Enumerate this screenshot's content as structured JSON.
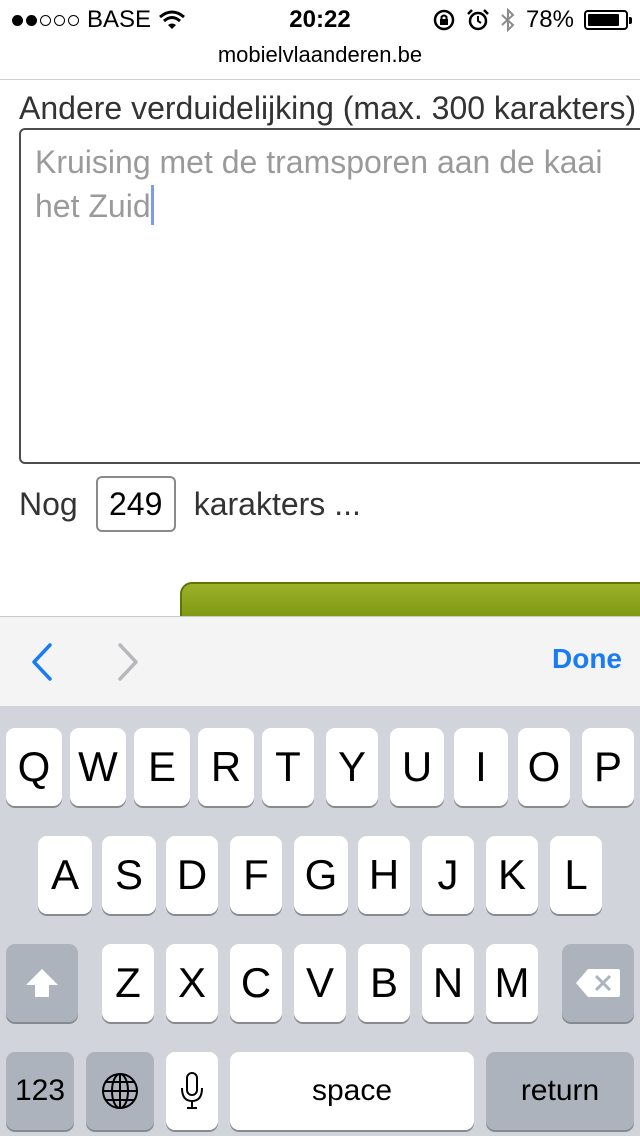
{
  "status": {
    "carrier": "BASE",
    "time": "20:22",
    "battery": "78%",
    "battery_level": 0.78
  },
  "browser": {
    "url": "mobielvlaanderen.be"
  },
  "form": {
    "label": "Andere verduidelijking (max. 300 karakters)",
    "textarea_lines": [
      "Kruising met de tramsporen aan de kaai",
      "het Zuid"
    ],
    "counter_prefix": "Nog",
    "counter_value": "249",
    "counter_suffix": "karakters ..."
  },
  "accessory": {
    "done_label": "Done"
  },
  "keyboard": {
    "row1": [
      "Q",
      "W",
      "E",
      "R",
      "T",
      "Y",
      "U",
      "I",
      "O",
      "P"
    ],
    "row2": [
      "A",
      "S",
      "D",
      "F",
      "G",
      "H",
      "J",
      "K",
      "L"
    ],
    "row3": [
      "Z",
      "X",
      "C",
      "V",
      "B",
      "N",
      "M"
    ],
    "numbers_label": "123",
    "space_label": "space",
    "return_label": "return"
  },
  "icons": {
    "signal": "signal-dots-icon",
    "wifi": "wifi-icon",
    "rotation_lock": "rotation-lock-icon",
    "alarm": "alarm-icon",
    "bluetooth": "bluetooth-icon",
    "battery": "battery-icon",
    "prev": "chevron-left-icon",
    "next": "chevron-right-icon",
    "shift": "shift-icon",
    "backspace": "backspace-icon",
    "globe": "globe-icon",
    "mic": "microphone-icon"
  },
  "colors": {
    "done": "#1a7cf5",
    "button_green": "#7a9400",
    "keyboard_bg": "#d1d5db"
  }
}
